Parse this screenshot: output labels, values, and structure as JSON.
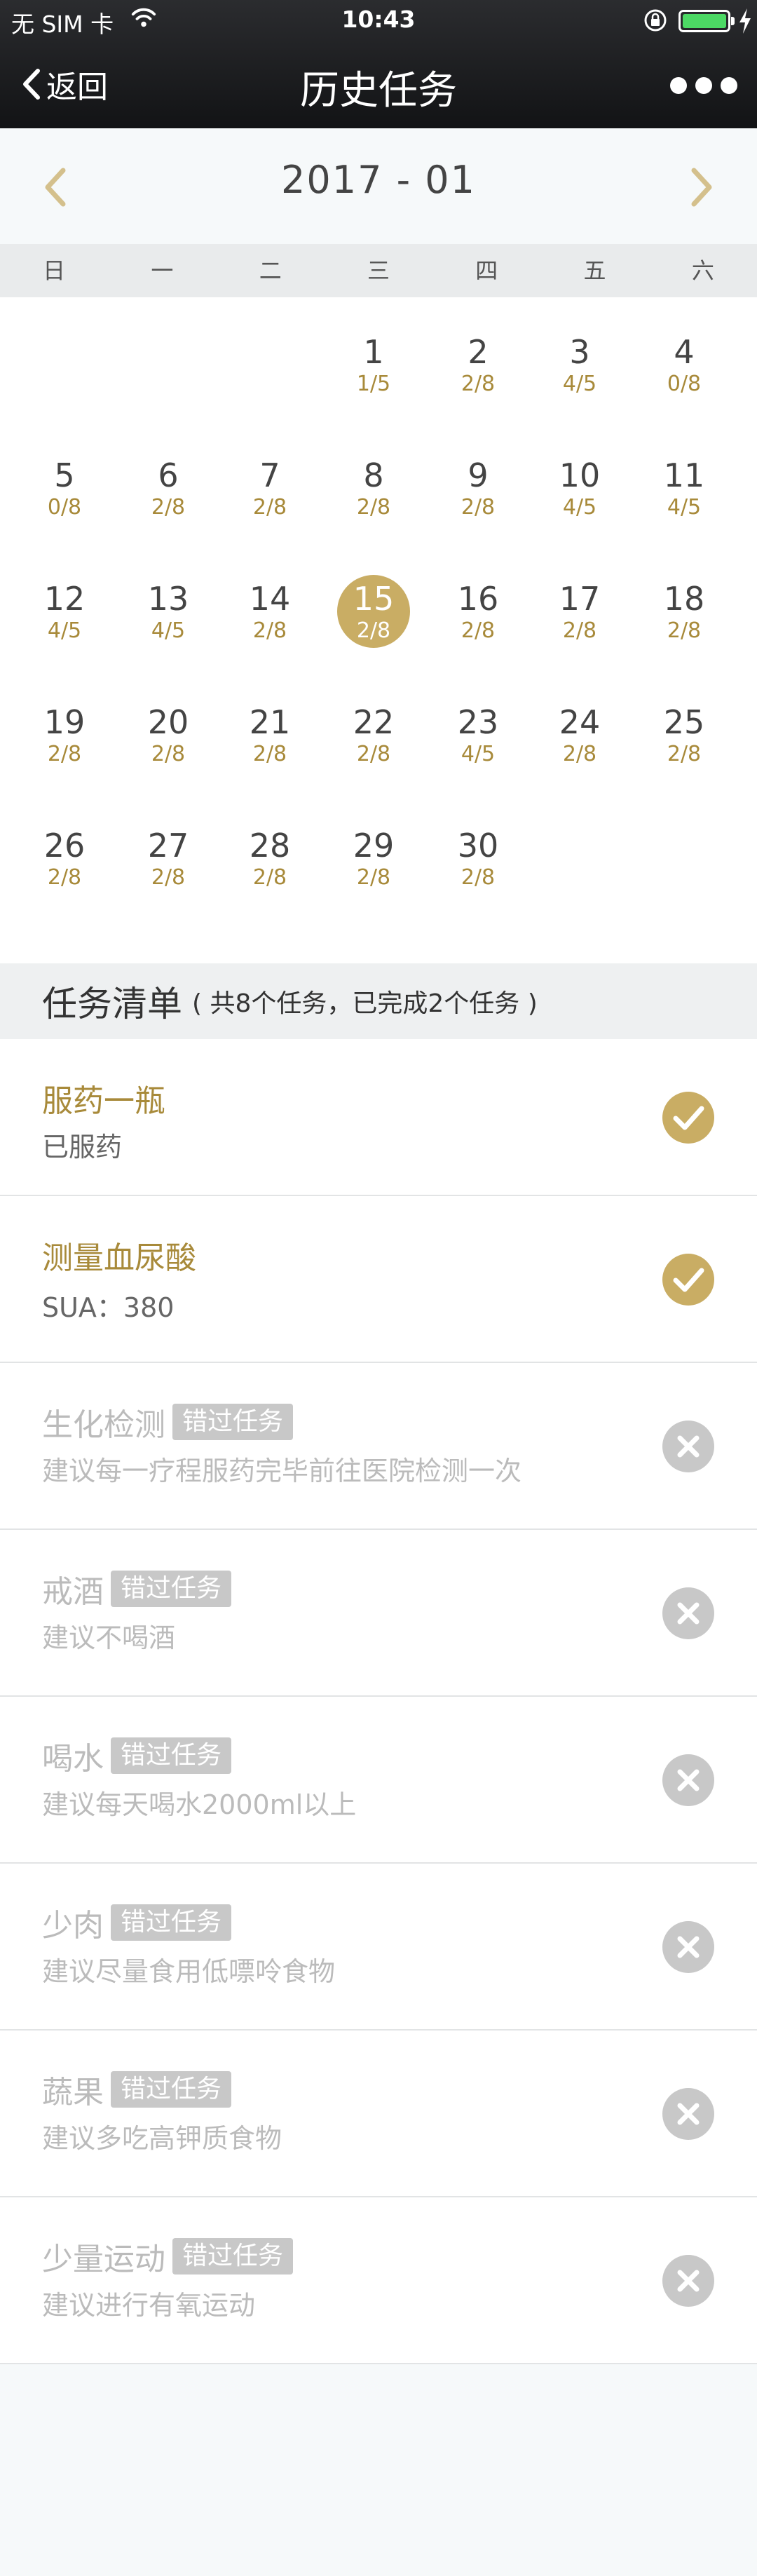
{
  "status_bar": {
    "carrier": "无 SIM 卡",
    "time": "10:43",
    "battery_color": "#4cd964"
  },
  "nav": {
    "back_label": "返回",
    "title": "历史任务",
    "more_icon": "more-dots-icon"
  },
  "calendar": {
    "month_label": "2017 - 01",
    "accent_color": "#c9ad64",
    "weekdays": [
      "日",
      "一",
      "二",
      "三",
      "四",
      "五",
      "六"
    ],
    "days": [
      {
        "day": "1",
        "count": "1/5"
      },
      {
        "day": "2",
        "count": "2/8"
      },
      {
        "day": "3",
        "count": "4/5"
      },
      {
        "day": "4",
        "count": "0/8"
      },
      {
        "day": "5",
        "count": "0/8"
      },
      {
        "day": "6",
        "count": "2/8"
      },
      {
        "day": "7",
        "count": "2/8"
      },
      {
        "day": "8",
        "count": "2/8"
      },
      {
        "day": "9",
        "count": "2/8"
      },
      {
        "day": "10",
        "count": "4/5"
      },
      {
        "day": "11",
        "count": "4/5"
      },
      {
        "day": "12",
        "count": "4/5"
      },
      {
        "day": "13",
        "count": "4/5"
      },
      {
        "day": "14",
        "count": "2/8"
      },
      {
        "day": "15",
        "count": "2/8",
        "selected": true
      },
      {
        "day": "16",
        "count": "2/8"
      },
      {
        "day": "17",
        "count": "2/8"
      },
      {
        "day": "18",
        "count": "2/8"
      },
      {
        "day": "19",
        "count": "2/8"
      },
      {
        "day": "20",
        "count": "2/8"
      },
      {
        "day": "21",
        "count": "2/8"
      },
      {
        "day": "22",
        "count": "2/8"
      },
      {
        "day": "23",
        "count": "4/5"
      },
      {
        "day": "24",
        "count": "2/8"
      },
      {
        "day": "25",
        "count": "2/8"
      },
      {
        "day": "26",
        "count": "2/8"
      },
      {
        "day": "27",
        "count": "2/8"
      },
      {
        "day": "28",
        "count": "2/8"
      },
      {
        "day": "29",
        "count": "2/8"
      },
      {
        "day": "30",
        "count": "2/8"
      }
    ]
  },
  "task_list": {
    "title": "任务清单",
    "summary": "( 共8个任务，已完成2个任务 )",
    "missed_tag": "错过任务",
    "tasks": [
      {
        "name": "服药一瓶",
        "desc": "已服药",
        "status": "done"
      },
      {
        "name": "测量血尿酸",
        "desc": "SUA：380",
        "status": "done"
      },
      {
        "name": "生化检测",
        "desc": "建议每一疗程服药完毕前往医院检测一次",
        "status": "missed"
      },
      {
        "name": "戒酒",
        "desc": "建议不喝酒",
        "status": "missed"
      },
      {
        "name": "喝水",
        "desc": "建议每天喝水2000ml以上",
        "status": "missed"
      },
      {
        "name": "少肉",
        "desc": "建议尽量食用低嘌呤食物",
        "status": "missed"
      },
      {
        "name": "蔬果",
        "desc": "建议多吃高钾质食物",
        "status": "missed"
      },
      {
        "name": "少量运动",
        "desc": "建议进行有氧运动",
        "status": "missed"
      }
    ]
  }
}
